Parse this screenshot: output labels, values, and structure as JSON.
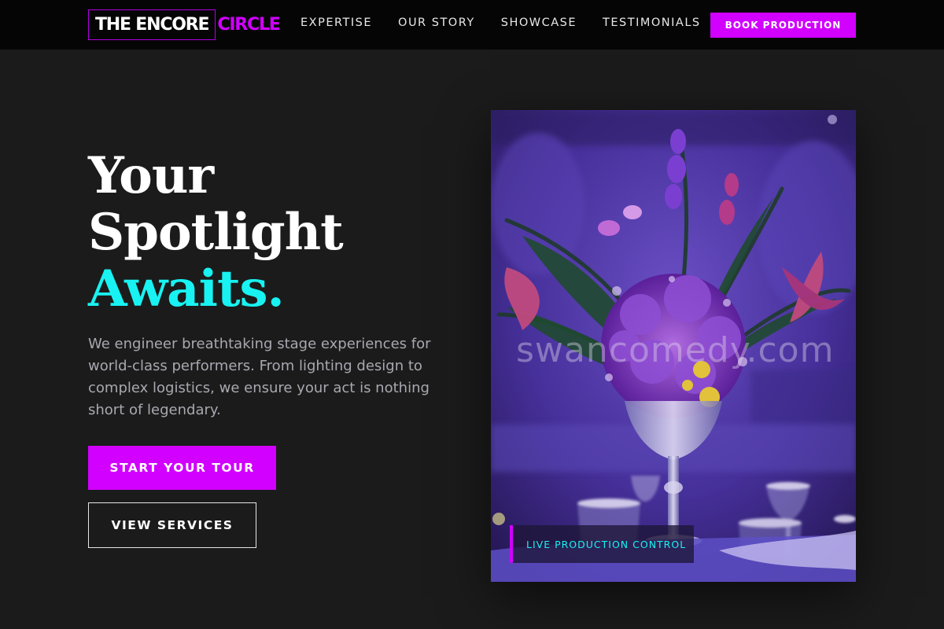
{
  "brand": {
    "name_main": "THE ENCORE",
    "name_accent": "CIRCLE"
  },
  "nav": {
    "items": [
      {
        "label": "EXPERTISE"
      },
      {
        "label": "OUR STORY"
      },
      {
        "label": "SHOWCASE"
      },
      {
        "label": "TESTIMONIALS"
      }
    ],
    "cta_label": "BOOK PRODUCTION"
  },
  "hero": {
    "headline_line1": "Your",
    "headline_line2": "Spotlight",
    "headline_accent": "Awaits.",
    "intro": "We engineer breathtaking stage experiences for world-class performers. From lighting design to complex logistics, we ensure your act is nothing short of legendary.",
    "primary_button": "START YOUR TOUR",
    "secondary_button": "VIEW SERVICES",
    "image_caption": "LIVE PRODUCTION CONTROL",
    "watermark": "swancomedy.com"
  },
  "colors": {
    "accent_magenta": "#d100ff",
    "accent_cyan": "#18f2f2",
    "background": "#1b1b1b",
    "topbar": "#050505"
  }
}
